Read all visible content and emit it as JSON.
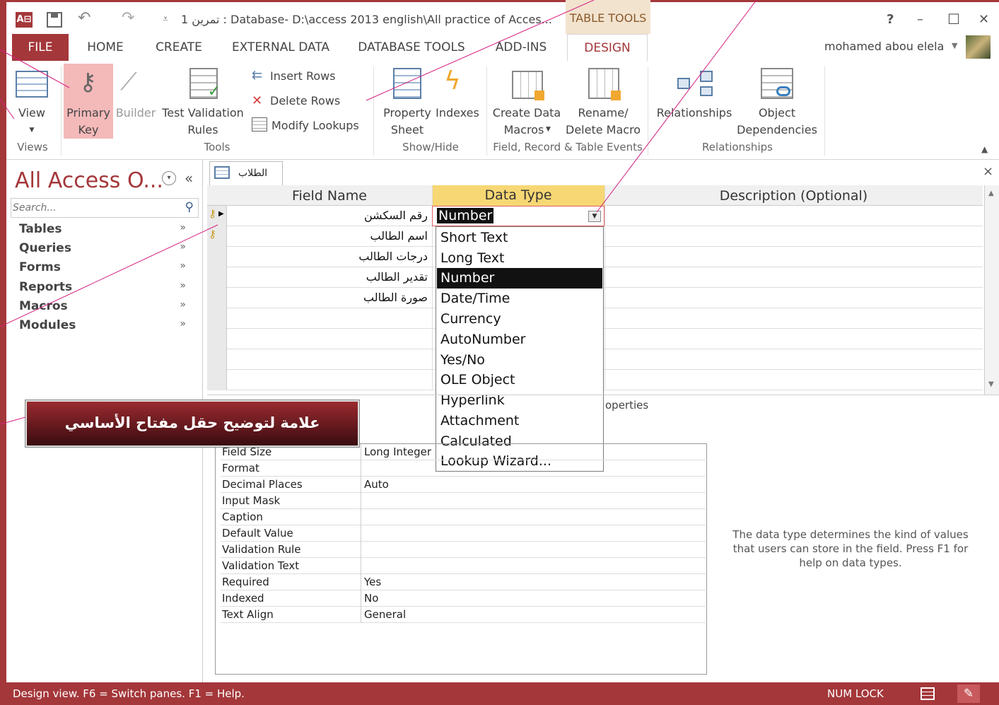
{
  "title_bar": {
    "app_icon": "access-icon",
    "title": "Database- D:\\access 2013 english\\All practice of Acces...",
    "title_prefix": "1 تمرين :",
    "context_group": "TABLE TOOLS",
    "help": "?",
    "minimize": "–",
    "maximize": "☐",
    "close": "✕"
  },
  "tabs": [
    "FILE",
    "HOME",
    "CREATE",
    "EXTERNAL DATA",
    "DATABASE TOOLS",
    "ADD-INS",
    "DESIGN"
  ],
  "user": "mohamed abou elela",
  "ribbon": {
    "view_label": "View",
    "primary_key_line1": "Primary",
    "primary_key_line2": "Key",
    "builder": "Builder",
    "test_validation_line1": "Test Validation",
    "test_validation_line2": "Rules",
    "insert_rows": "Insert Rows",
    "delete_rows": "Delete Rows",
    "modify_lookups": "Modify Lookups",
    "property_sheet_line1": "Property",
    "property_sheet_line2": "Sheet",
    "indexes": "Indexes",
    "create_data_macros_line1": "Create Data",
    "create_data_macros_line2": "Macros",
    "rename_macro_line1": "Rename/",
    "rename_macro_line2": "Delete Macro",
    "relationships": "Relationships",
    "object_deps_line1": "Object",
    "object_deps_line2": "Dependencies",
    "groups": {
      "views": "Views",
      "tools": "Tools",
      "show_hide": "Show/Hide",
      "events": "Field, Record & Table Events",
      "relationships": "Relationships"
    }
  },
  "nav_pane": {
    "title": "All Access O...",
    "search_placeholder": "Search...",
    "items": [
      "Tables",
      "Queries",
      "Forms",
      "Reports",
      "Macros",
      "Modules"
    ]
  },
  "document": {
    "tab_label": "الطلاب",
    "close": "×",
    "headers": {
      "field_name": "Field Name",
      "data_type": "Data Type",
      "description": "Description (Optional)"
    },
    "fields": [
      "رقم السكشن",
      "اسم الطالب",
      "درجات الطالب",
      "تقدير الطالب",
      "صورة الطالب"
    ],
    "current_type": "Number",
    "field_properties_tail": "operties"
  },
  "data_type_options": [
    "Short Text",
    "Long Text",
    "Number",
    "Date/Time",
    "Currency",
    "AutoNumber",
    "Yes/No",
    "OLE Object",
    "Hyperlink",
    "Attachment",
    "Calculated",
    "Lookup Wizard..."
  ],
  "properties": [
    {
      "label": "Field Size",
      "value": "Long Integer"
    },
    {
      "label": "Format",
      "value": ""
    },
    {
      "label": "Decimal Places",
      "value": "Auto"
    },
    {
      "label": "Input Mask",
      "value": ""
    },
    {
      "label": "Caption",
      "value": ""
    },
    {
      "label": "Default Value",
      "value": ""
    },
    {
      "label": "Validation Rule",
      "value": ""
    },
    {
      "label": "Validation Text",
      "value": ""
    },
    {
      "label": "Required",
      "value": "Yes"
    },
    {
      "label": "Indexed",
      "value": "No"
    },
    {
      "label": "Text Align",
      "value": "General"
    }
  ],
  "help_text": "The data type determines the kind of values that users can store in the field. Press F1 for help on data types.",
  "callout": "علامة لتوضيح حقل مفتاح الأساسي",
  "status": {
    "left": "Design view.  F6 = Switch panes.  F1 = Help.",
    "num_lock": "NUM LOCK"
  },
  "colors": {
    "accent": "#a4373a",
    "selected_option": "#111111",
    "data_type_header": "#f7d774"
  }
}
